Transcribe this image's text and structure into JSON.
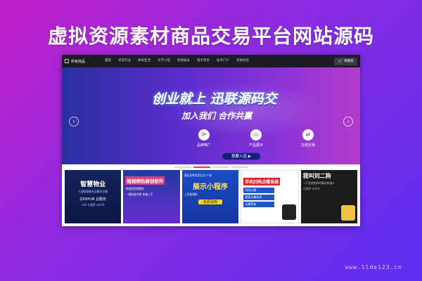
{
  "headline": "虚拟资源素材商品交易平台网站源码",
  "site": {
    "brand_label": "所有商品",
    "nav": [
      "首页",
      "考前行业",
      "休闲生活",
      "文学小说",
      "影视娱乐",
      "电子商务",
      "技术门户",
      "其他综合"
    ],
    "cart_label": "购物车",
    "banner": {
      "slogan_main": "创业就上 迅联源码交",
      "slogan_sub": "加入我们 合作共赢",
      "features": [
        {
          "icon": "share-icon",
          "glyph": "⟳",
          "label": "品牌推广"
        },
        {
          "icon": "display-icon",
          "glyph": "▭",
          "label": "产品展示"
        },
        {
          "icon": "exchange-icon",
          "glyph": "⇄",
          "label": "在线交易"
        }
      ],
      "join_label": "我要入驻 ▶"
    },
    "cards": [
      {
        "title": "智慧物业",
        "line1": "七星级智能社区解决方案",
        "line2": "ZXNYUN 云服务",
        "tag": "APP 小程序 公众号"
      },
      {
        "title": "短视频伪原创软件",
        "line1": "海量短视频素材",
        "line2": "一键批量处理 快速上手"
      },
      {
        "title": "展示小程序",
        "line1": "满足各种类型企业/个体",
        "line2": "上百套模板",
        "free": "免费试用"
      },
      {
        "title": "手机扫码点餐系统",
        "items": [
          "扫码点餐",
          "提高点餐效率",
          "无需等待"
        ]
      },
      {
        "title": "我叫刘二狗",
        "line1": "一只会说相声的聊天机器人",
        "line2": "小程序 公众号"
      }
    ]
  },
  "watermark": "www.llde123.cn",
  "colors": {
    "accent_red": "#ff3b30",
    "banner_start": "#2a2f9e",
    "banner_end": "#b43cc9"
  }
}
